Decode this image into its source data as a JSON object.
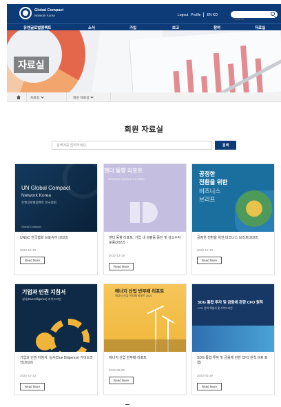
{
  "header": {
    "logo_line1": "Global Compact",
    "logo_line2": "Network Korea",
    "login": "Logout",
    "profile": "Profile",
    "lang": "EN KO",
    "search_placeholder": "Search"
  },
  "nav": [
    "유엔글로벌콤팩트",
    "소식",
    "가입",
    "보고",
    "참여",
    "자료실"
  ],
  "hero": {
    "title": "자료실"
  },
  "breadcrumb": {
    "level1": "자료실",
    "level2": "회원 자료실"
  },
  "main": {
    "title": "회원 자료실",
    "search_placeholder": "검색어를 입력하세요.",
    "search_button": "검색"
  },
  "cards": [
    {
      "caption": "UNGC 한국협회 브로슈어 (2022)",
      "date": "2022-12-19",
      "more": "Read More",
      "cover": {
        "title": "UN Global Compact",
        "subtitle": "Network Korea",
        "line3": "유엔글로벌콤팩트 한국협회",
        "badge": "Global Compact"
      }
    },
    {
      "caption": "젠더 동향 리포트: 기업 내 성평등 증진 및 성소수자 포용(2022)",
      "date": "2022-12-19",
      "more": "Read More",
      "cover": {
        "title": "젠더 동향 리포트",
        "subtitle": "GENDER EQUALITY KOREA"
      }
    },
    {
      "caption": "공정한 전환을 위한 비즈니스 브리프(2022)",
      "date": "2022-12-13",
      "more": "Read More",
      "cover": {
        "line1": "공정한",
        "line2": "전환을 위한",
        "line3": "비즈니스",
        "line4": "브리프"
      }
    },
    {
      "caption": "기업과 인권 지침서: 실사(Due Diligence) 가이드라인(2022)",
      "date": "2022-12-13",
      "more": "Read More",
      "cover": {
        "title": "기업과 인권 지침서",
        "subtitle": "실사(Due Diligence) 가이드라인"
      }
    },
    {
      "caption": "에너지 산업 반부패 리포트",
      "date": "2022-08-05",
      "more": "Read More",
      "cover": {
        "title": "에너지 산업 반부패 리포트",
        "subtitle": "에너지 산업 반부패 리포트 2022"
      }
    },
    {
      "caption": "SDG 통합 투자 및 금융에 관한 CFO 원칙 (KR 포함)",
      "date": "2022-01-28",
      "more": "Read More",
      "cover": {
        "title": "SDG 통합 투자 및 금융에 관한 CFO 원칙",
        "subtitle": "CFO 원칙 해설서 및 가이드라인"
      }
    }
  ],
  "colors": {
    "brand_navy": "#0d3b78",
    "accent_orange": "#e5674b",
    "cover_lavender": "#c4bfe0",
    "cover_teal": "#1a6f9e",
    "cover_gold": "#f0b63a"
  }
}
